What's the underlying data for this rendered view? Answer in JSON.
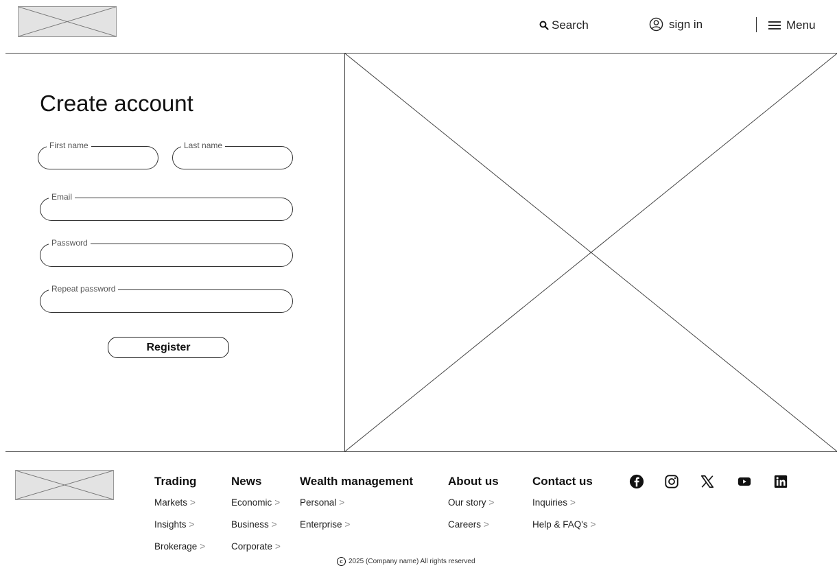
{
  "header": {
    "search_label": "Search",
    "signin_label": "sign in",
    "menu_label": "Menu"
  },
  "form": {
    "title": "Create account",
    "first_name_label": "First name",
    "last_name_label": "Last name",
    "email_label": "Email",
    "password_label": "Password",
    "repeat_password_label": "Repeat password",
    "register_label": "Register"
  },
  "footer": {
    "columns": [
      {
        "title": "Trading",
        "links": [
          "Markets",
          "Insights",
          "Brokerage"
        ]
      },
      {
        "title": "News",
        "links": [
          "Economic",
          "Business",
          "Corporate"
        ]
      },
      {
        "title": "Wealth management",
        "links": [
          "Personal",
          "Enterprise"
        ]
      },
      {
        "title": "About us",
        "links": [
          "Our story",
          "Careers"
        ]
      },
      {
        "title": "Contact us",
        "links": [
          "Inquiries",
          "Help & FAQ's"
        ]
      }
    ],
    "chevron": ">",
    "social_icons": [
      "facebook-icon",
      "instagram-icon",
      "x-icon",
      "youtube-icon",
      "linkedin-icon"
    ],
    "copyright_symbol": "c",
    "copyright": "2025 (Company name) All rights reserved"
  }
}
